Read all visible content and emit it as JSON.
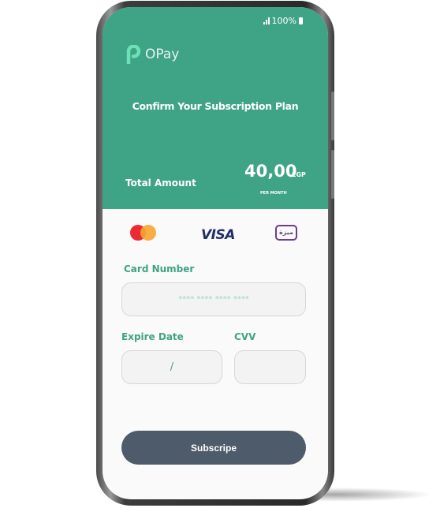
{
  "status_bar": {
    "battery": "100%"
  },
  "brand": {
    "name": "OPay"
  },
  "header": {
    "title": "Confirm Your Subscription Plan",
    "total_label": "Total Amount",
    "amount": "40,00",
    "currency": "EGP",
    "period": "PER MONTH"
  },
  "payment_methods": {
    "mastercard": "mastercard",
    "visa": "VISA",
    "meeza": "ميزة"
  },
  "form": {
    "card_number_label": "Card Number",
    "card_number_placeholder": "****  ****  ****  ****",
    "expire_label": "Expire Date",
    "expire_placeholder": "/",
    "cvv_label": "CVV",
    "cvv_value": ""
  },
  "submit_label": "Subscripe",
  "colors": {
    "primary": "#3fa385",
    "button": "#4e5b6a"
  }
}
